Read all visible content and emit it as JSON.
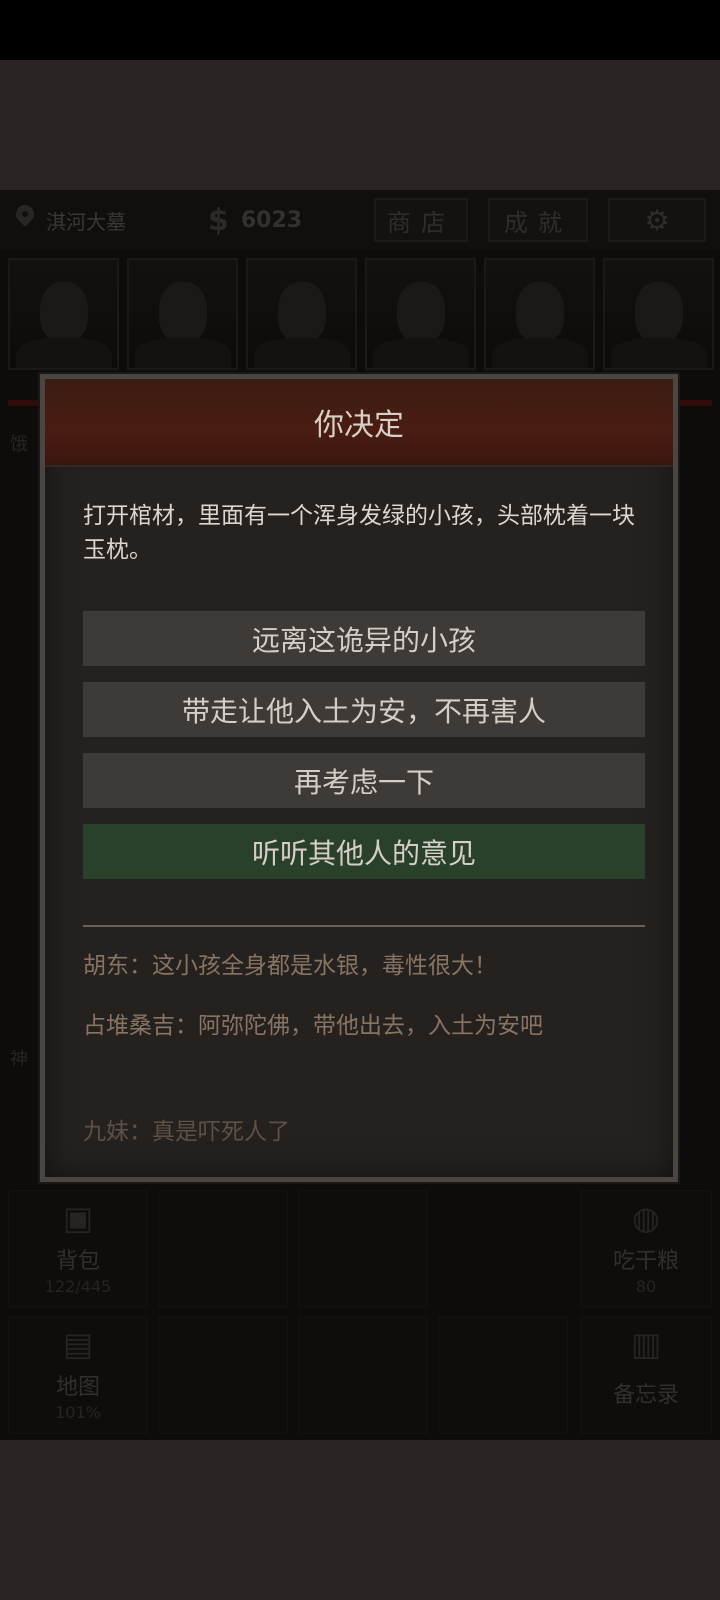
{
  "header": {
    "location": "淇河大墓",
    "money_symbol": "$",
    "money": "6023",
    "shop_label": "商店",
    "achievement_label": "成就",
    "settings_icon": "gear-icon"
  },
  "portraits": [
    "portrait-1",
    "portrait-2",
    "portrait-3",
    "portrait-4",
    "portrait-5",
    "portrait-6"
  ],
  "side_labels": {
    "hunger": "饿",
    "spirit": "神"
  },
  "bottom_grid": {
    "backpack": {
      "label": "背包",
      "count": "122/445"
    },
    "eat": {
      "label": "吃干粮",
      "count": "80"
    },
    "map": {
      "label": "地图",
      "count": "101%"
    },
    "memo": {
      "label": "备忘录"
    }
  },
  "dialog": {
    "title": "你决定",
    "description": "打开棺材，里面有一个浑身发绿的小孩，头部枕着一块玉枕。",
    "options": [
      "远离这诡异的小孩",
      "带走让他入土为安，不再害人",
      "再考虑一下",
      "听听其他人的意见"
    ],
    "comments": [
      {
        "speaker": "胡东：",
        "text": "这小孩全身都是水银，毒性很大！"
      },
      {
        "speaker": "占堆桑吉：",
        "text": "阿弥陀佛，带他出去，入土为安吧"
      },
      {
        "speaker": "九妹：",
        "text": "真是吓死人了"
      }
    ],
    "highlight_color": "#29402b"
  }
}
